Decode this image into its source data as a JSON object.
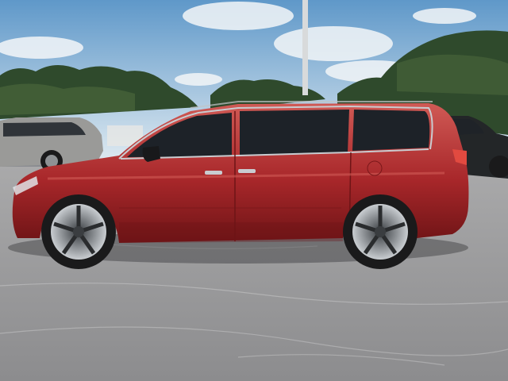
{
  "scene": {
    "subject": "red-minivan",
    "colors": {
      "sky_top": "#5f98c9",
      "sky_bottom": "#dce8f0",
      "cloud": "#f3f6f8",
      "trees": "#2f4a2c",
      "trees_light": "#4f6b3e",
      "ground": "#8c8c8e",
      "ground_light": "#a9a9aa",
      "van_body": "#a8272a",
      "van_shadow": "#6e1416",
      "van_highlight": "#d05a55",
      "window": "#1d2228",
      "wheel_tire": "#1a1a1b",
      "rim": "#c9cdd1",
      "silver_suv": "#9a9a98",
      "dark_truck": "#232628",
      "pole": "#d8dadb"
    }
  }
}
